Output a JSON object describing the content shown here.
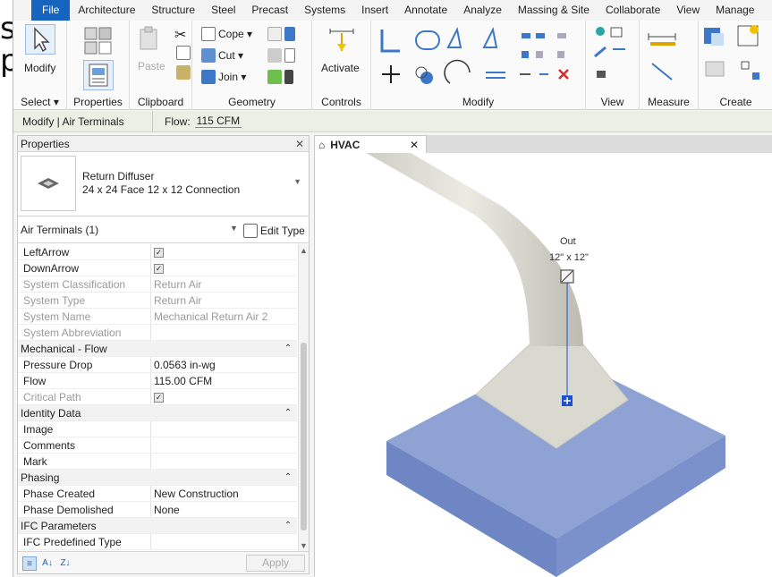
{
  "ribbon_tabs": [
    "File",
    "Architecture",
    "Structure",
    "Steel",
    "Precast",
    "Systems",
    "Insert",
    "Annotate",
    "Analyze",
    "Massing & Site",
    "Collaborate",
    "View",
    "Manage"
  ],
  "ribbon": {
    "select": {
      "modify_label": "Modify",
      "panel_label": "Select ▾"
    },
    "properties": {
      "panel_label": "Properties"
    },
    "clipboard": {
      "paste_label": "Paste",
      "panel_label": "Clipboard"
    },
    "geometry": {
      "cope_label": "Cope ▾",
      "cut_label": "Cut ▾",
      "join_label": "Join ▾",
      "panel_label": "Geometry"
    },
    "controls": {
      "activate_label": "Activate",
      "panel_label": "Controls"
    },
    "modify": {
      "panel_label": "Modify"
    },
    "view": {
      "panel_label": "View"
    },
    "measure": {
      "panel_label": "Measure"
    },
    "create": {
      "panel_label": "Create"
    }
  },
  "options_bar": {
    "context": "Modify | Air Terminals",
    "flow_label": "Flow:",
    "flow_value": "115 CFM"
  },
  "properties_panel": {
    "title": "Properties",
    "type_family": "Return Diffuser",
    "type_name": "24 x 24 Face 12 x 12 Connection",
    "filter": "Air Terminals (1)",
    "edit_type": "Edit Type",
    "rows": [
      {
        "k": "LeftArrow",
        "v": "",
        "check": true,
        "dim": false
      },
      {
        "k": "DownArrow",
        "v": "",
        "check": true,
        "dim": false
      },
      {
        "k": "System Classification",
        "v": "Return Air",
        "dim": true
      },
      {
        "k": "System Type",
        "v": "Return Air",
        "dim": true
      },
      {
        "k": "System Name",
        "v": "Mechanical Return Air 2",
        "dim": true
      },
      {
        "k": "System Abbreviation",
        "v": "",
        "dim": true
      },
      {
        "group": "Mechanical - Flow"
      },
      {
        "k": "Pressure Drop",
        "v": "0.0563 in-wg",
        "dim": false
      },
      {
        "k": "Flow",
        "v": "115.00 CFM",
        "dim": false
      },
      {
        "k": "Critical Path",
        "v": "",
        "check": true,
        "dim": true
      },
      {
        "group": "Identity Data"
      },
      {
        "k": "Image",
        "v": "",
        "dim": false
      },
      {
        "k": "Comments",
        "v": "",
        "dim": false
      },
      {
        "k": "Mark",
        "v": "",
        "dim": false
      },
      {
        "group": "Phasing"
      },
      {
        "k": "Phase Created",
        "v": "New Construction",
        "dim": false
      },
      {
        "k": "Phase Demolished",
        "v": "None",
        "dim": false
      },
      {
        "group": "IFC Parameters"
      },
      {
        "k": "IFC Predefined Type",
        "v": "",
        "dim": false
      }
    ],
    "apply": "Apply"
  },
  "view": {
    "tab": "HVAC",
    "out_label": "Out",
    "size_label": "12\" x 12\""
  },
  "colors": {
    "file_tab": "#1565c0",
    "diffuser_face": "#8ea2d4",
    "duct": "#e4e4dc",
    "selection": "#1a4fd6"
  }
}
